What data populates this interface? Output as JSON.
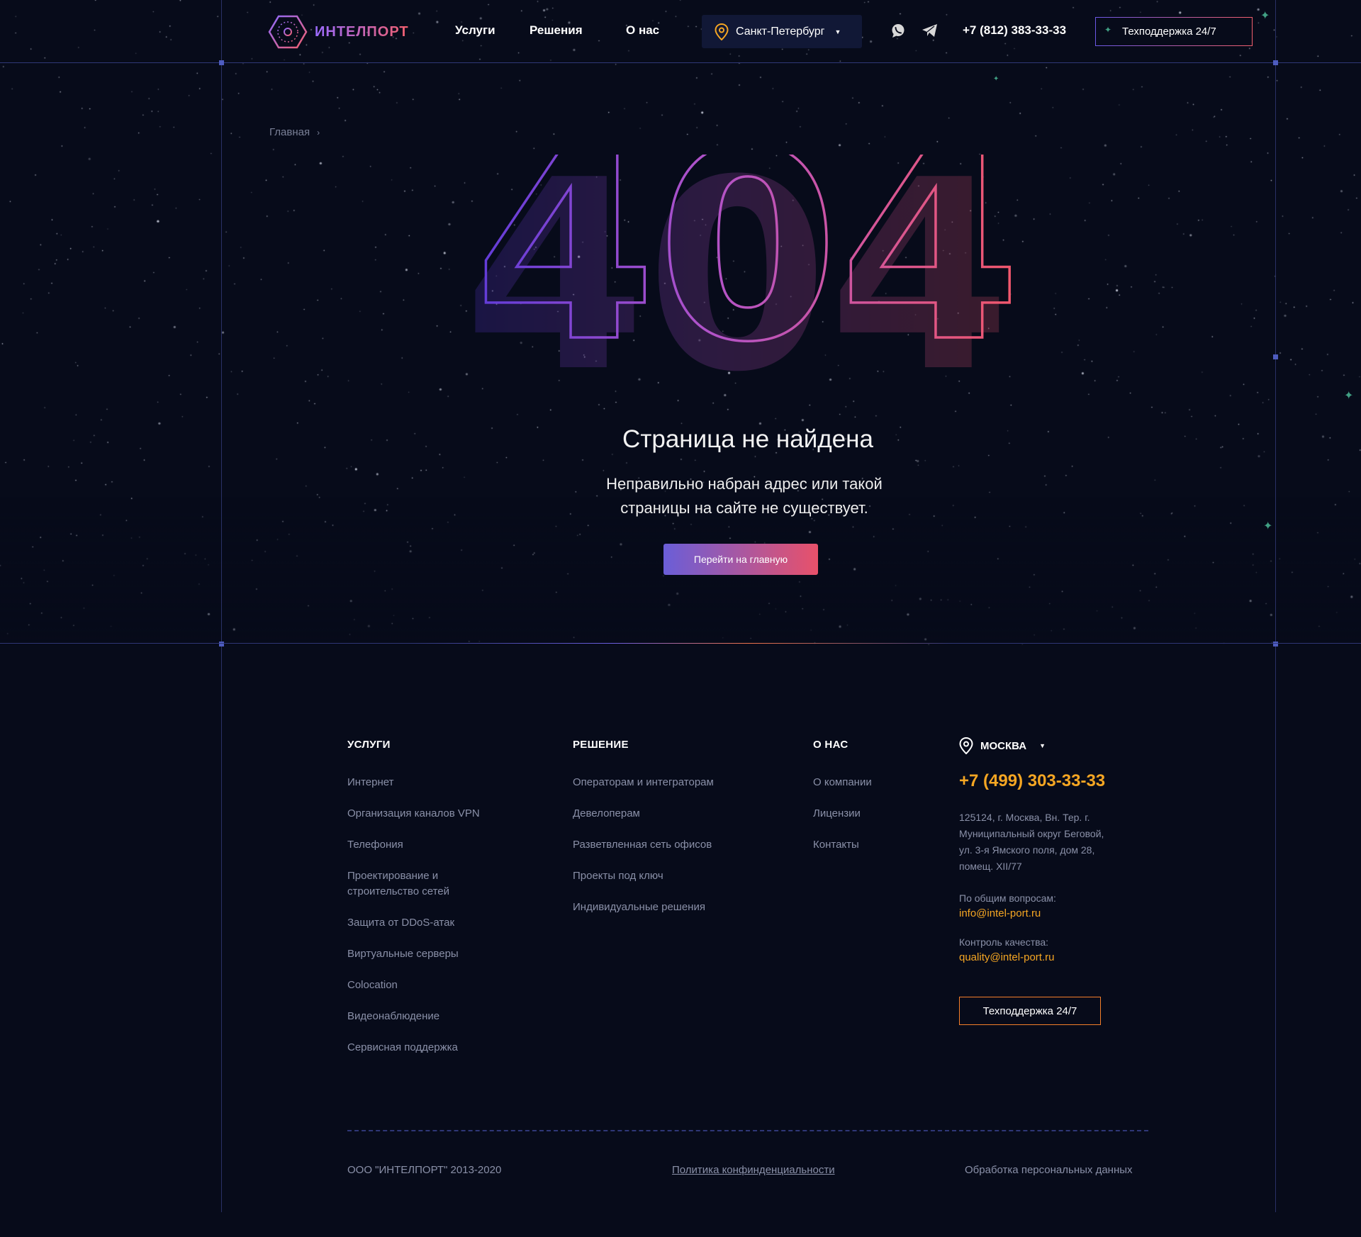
{
  "header": {
    "logo_text": "ИНТЕЛПОРТ",
    "nav": [
      "Услуги",
      "Решения",
      "О нас"
    ],
    "city": "Санкт-Петербург",
    "phone": "+7 (812) 383-33-33",
    "support": "Техподдержка 24/7"
  },
  "breadcrumb": {
    "home": "Главная"
  },
  "error": {
    "code": "404",
    "title": "Страница не найдена",
    "subtitle_line1": "Неправильно набран адрес или такой",
    "subtitle_line2": "страницы на сайте не существует.",
    "button": "Перейти на главную"
  },
  "footer": {
    "services": {
      "heading": "УСЛУГИ",
      "items": [
        "Интернет",
        "Организация каналов VPN",
        "Телефония",
        "Проектирование и строительство сетей",
        "Защита от DDoS-атак",
        "Виртуальные серверы",
        "Colocation",
        "Видеонаблюдение",
        "Сервисная поддержка"
      ]
    },
    "solutions": {
      "heading": "РЕШЕНИЕ",
      "items": [
        "Операторам и интеграторам",
        "Девелоперам",
        "Разветвленная сеть офисов",
        "Проекты под ключ",
        "Индивидуальные решения"
      ]
    },
    "about": {
      "heading": "О НАС",
      "items": [
        "О компании",
        "Лицензии",
        "Контакты"
      ]
    },
    "contacts": {
      "city": "МОСКВА",
      "phone": "+7 (499) 303-33-33",
      "address_lines": [
        "125124, г. Москва, Вн. Тер. г.",
        "Муниципальный округ Беговой,",
        "ул. 3-я Ямского поля, дом 28,",
        "помещ. XII/77"
      ],
      "general_label": "По общим вопросам:",
      "general_email": "info@intel-port.ru",
      "quality_label": "Контроль качества:",
      "quality_email": "quality@intel-port.ru",
      "support": "Техподдержка 24/7"
    },
    "copyright": "ООО \"ИНТЕЛПОРТ\" 2013-2020",
    "privacy": "Политика конфинденциальности",
    "personal_data": "Обработка персональных данных"
  },
  "colors": {
    "background": "#070b1a",
    "accent_orange": "#f5a623",
    "gradient_start": "#6a5ed8",
    "gradient_end": "#e8516a"
  },
  "icons": [
    "logo-icon",
    "location-pin-icon",
    "whatsapp-icon",
    "telegram-icon",
    "sparkle-icon",
    "chevron-right-icon",
    "caret-down-icon"
  ]
}
